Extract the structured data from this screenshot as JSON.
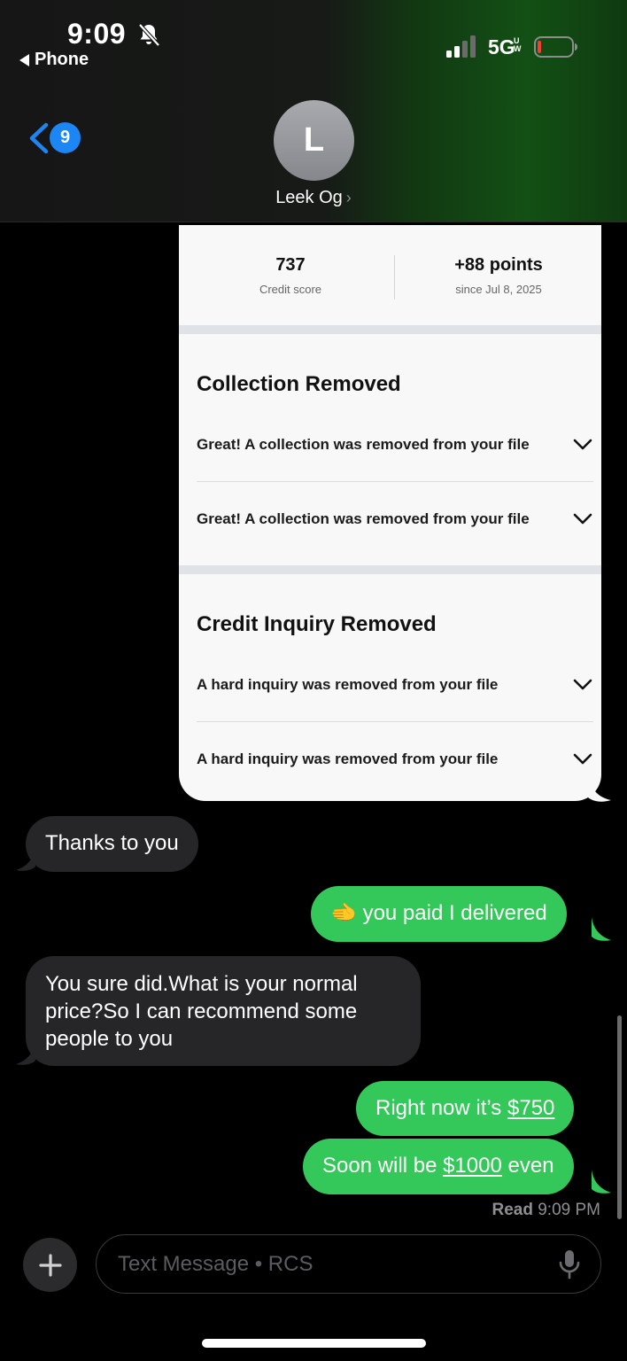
{
  "status_bar": {
    "time": "9:09",
    "back_app": "Phone",
    "network": "5G",
    "network_suffix": "UW"
  },
  "nav": {
    "unread_count": "9",
    "avatar_initial": "L",
    "contact_name": "Leek Og"
  },
  "shared_card": {
    "stats": [
      {
        "value": "737",
        "label": "Credit score"
      },
      {
        "value": "+88 points",
        "label": "since Jul 8, 2025"
      }
    ],
    "sections": [
      {
        "title": "Collection Removed",
        "items": [
          "Great! A collection was removed from your file",
          "Great! A collection was removed from your file"
        ]
      },
      {
        "title": "Credit Inquiry Removed",
        "items": [
          "A hard inquiry was removed from your file",
          "A hard inquiry was removed from your file"
        ]
      }
    ]
  },
  "messages": [
    {
      "direction": "incoming",
      "text": "Thanks to you"
    },
    {
      "direction": "outgoing",
      "emoji": "🫲",
      "text": "you paid I delivered"
    },
    {
      "direction": "incoming",
      "lines": [
        "You sure did.What is your normal",
        "price?So I can recommend some",
        "people to you"
      ]
    },
    {
      "direction": "outgoing",
      "text_before": "Right now it’s ",
      "link": "$750"
    },
    {
      "direction": "outgoing",
      "text_before": "Soon will be ",
      "link": "$1000",
      "text_after": " even"
    }
  ],
  "receipt": {
    "label": "Read",
    "time": "9:09 PM"
  },
  "composer": {
    "placeholder": "Text Message • RCS"
  },
  "colors": {
    "outgoing": "#34c759",
    "incoming": "#262628",
    "badge": "#1d86f5"
  },
  "icons": [
    "bell-slash-icon",
    "signal-icon",
    "battery-icon",
    "back-chevron-icon",
    "chevron-down-icon",
    "plus-icon",
    "microphone-icon"
  ]
}
